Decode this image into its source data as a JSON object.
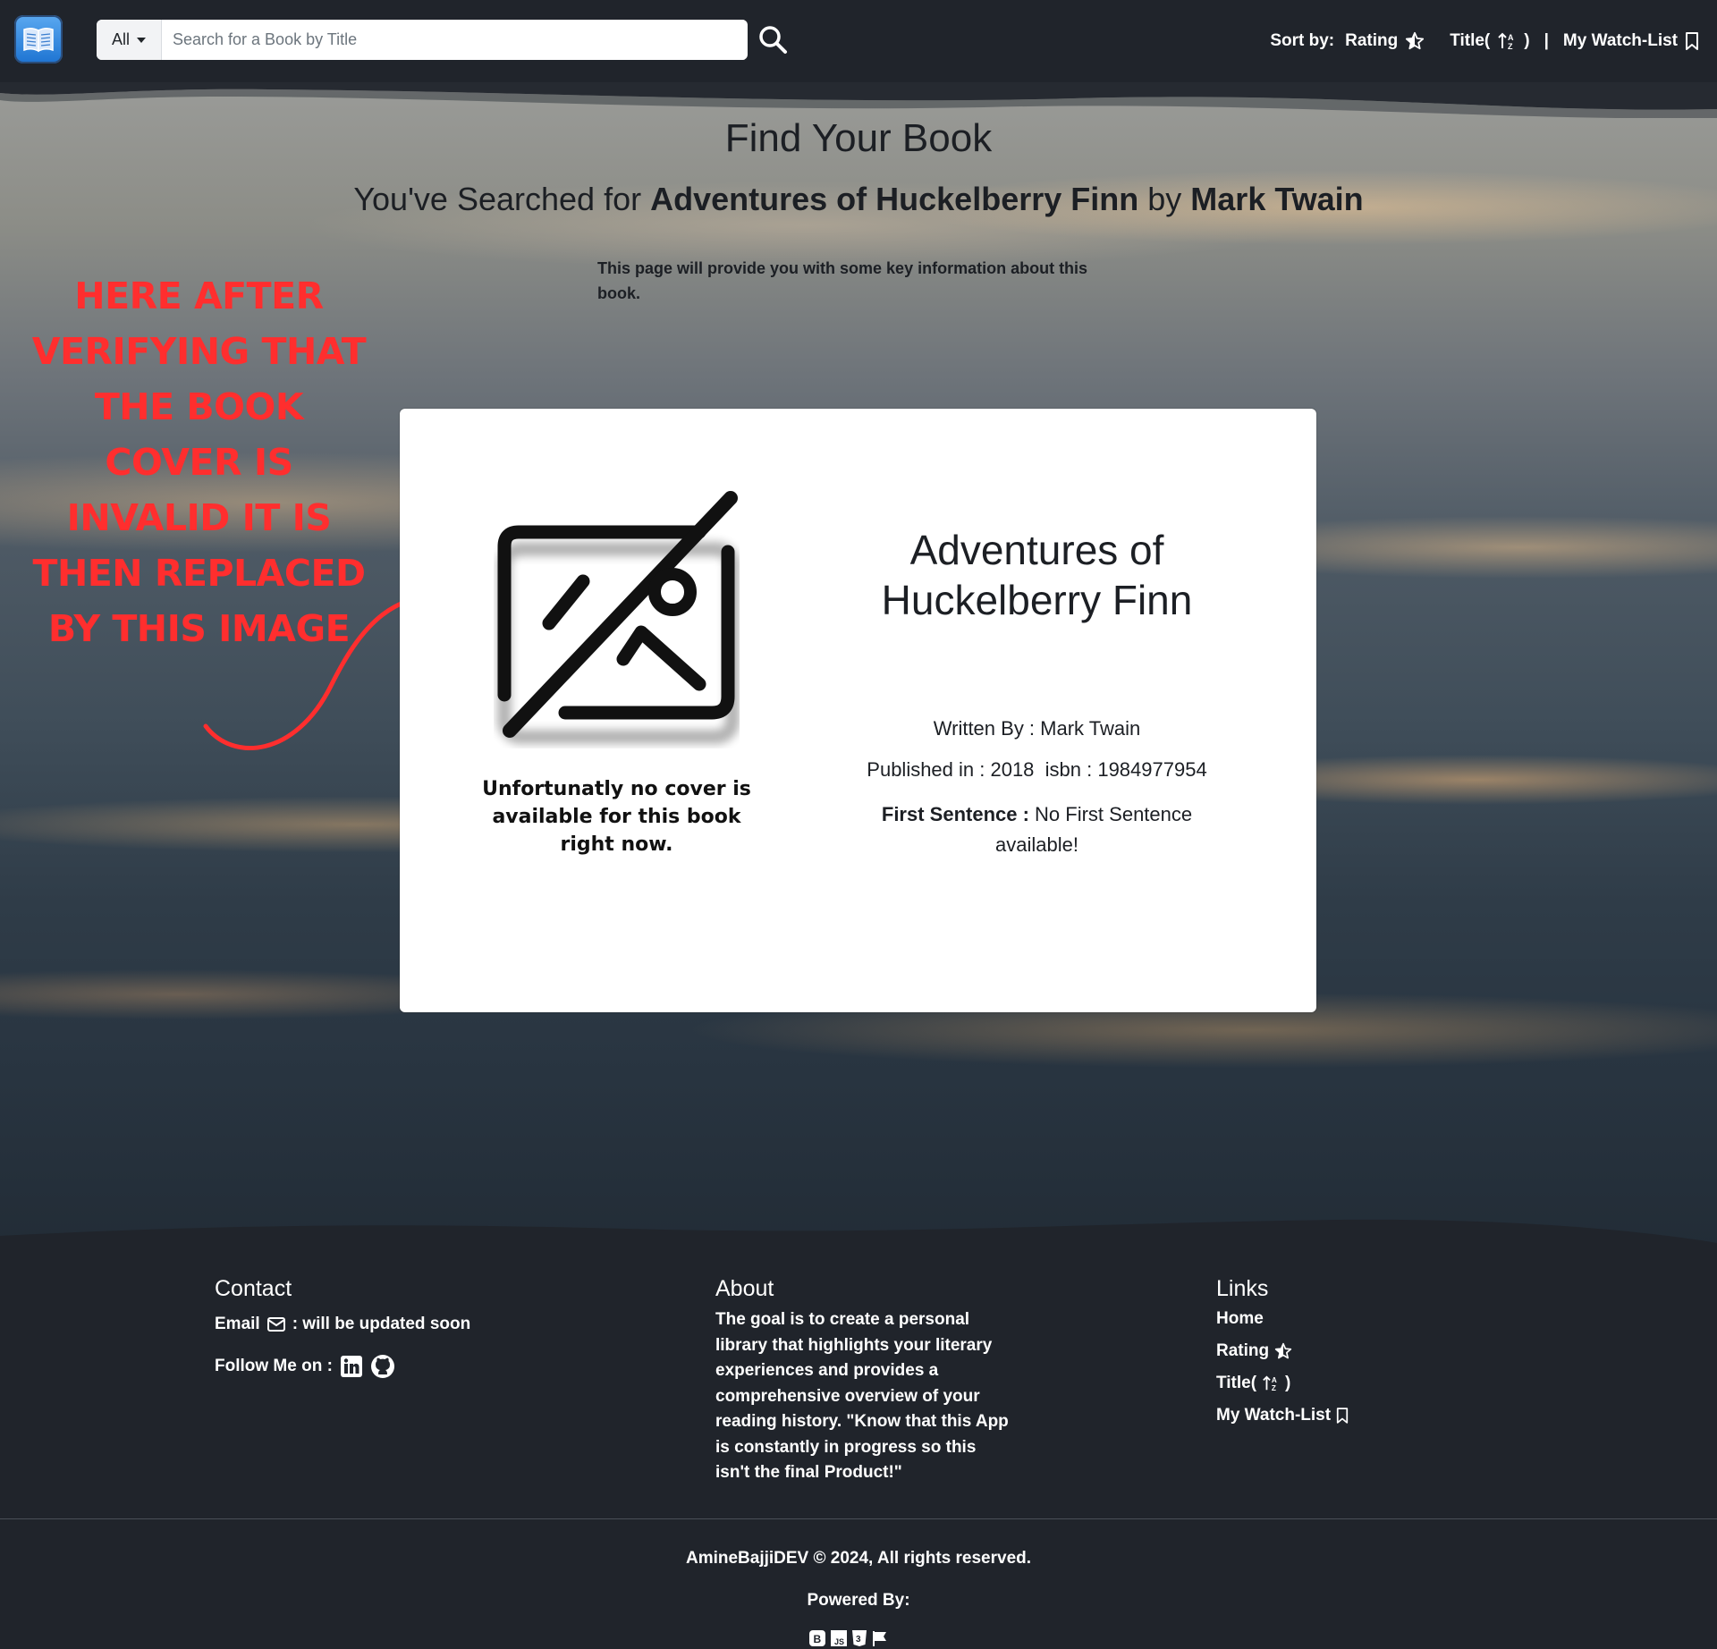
{
  "navbar": {
    "search_category": "All",
    "search_placeholder": "Search for a Book by Title",
    "sort_by_label": "Sort by:",
    "rating_label": "Rating",
    "title_label": "Title(",
    "title_close": ")",
    "separator": "|",
    "watchlist_label": "My Watch-List"
  },
  "hero": {
    "page_title": "Find Your Book",
    "searched_prefix": "You've Searched for",
    "searched_book": "Adventures of Huckelberry Finn",
    "searched_by": "by",
    "searched_author": "Mark Twain",
    "info_text": "This page will provide you with some key information about this book.",
    "annotation": "HERE AFTER VERIFYING THAT THE BOOK COVER IS INVALID IT IS THEN REPLACED BY THIS IMAGE"
  },
  "book": {
    "no_cover_text": "Unfortunatly no cover is available for this book right now.",
    "title": "Adventures of Huckelberry Finn",
    "written_by": "Written By : Mark Twain",
    "published": "Published in : 2018  isbn : 1984977954",
    "first_sentence_label": "First Sentence :",
    "first_sentence_value": "No First Sentence available!"
  },
  "footer": {
    "contact_heading": "Contact",
    "email_label": "Email",
    "email_value": ": will be updated soon",
    "follow_label": "Follow Me on :",
    "about_heading": "About",
    "about_text": "The goal is to create a personal library that highlights your literary experiences and provides a comprehensive overview of your reading history. \"Know that this App is constantly in progress so this isn't the final Product!\"",
    "links_heading": "Links",
    "links": [
      {
        "label": "Home"
      },
      {
        "label": "Rating"
      },
      {
        "label": "Title("
      },
      {
        "label": "My Watch-List"
      }
    ],
    "title_close": ")",
    "copyright": "AmineBajjiDEV © 2024, All rights reserved.",
    "powered_by": "Powered By:"
  },
  "icons": {
    "logo": "book-open-icon",
    "search": "search-icon",
    "rating": "star-half-icon",
    "sort": "sort-alpha-icon",
    "bookmark": "bookmark-icon",
    "no_image": "image-off-icon",
    "email": "envelope-icon",
    "linkedin": "linkedin-icon",
    "github": "github-icon"
  },
  "colors": {
    "navbar": "#20242b",
    "annotation": "#ff2e2e",
    "logo": "#2f86e0"
  }
}
